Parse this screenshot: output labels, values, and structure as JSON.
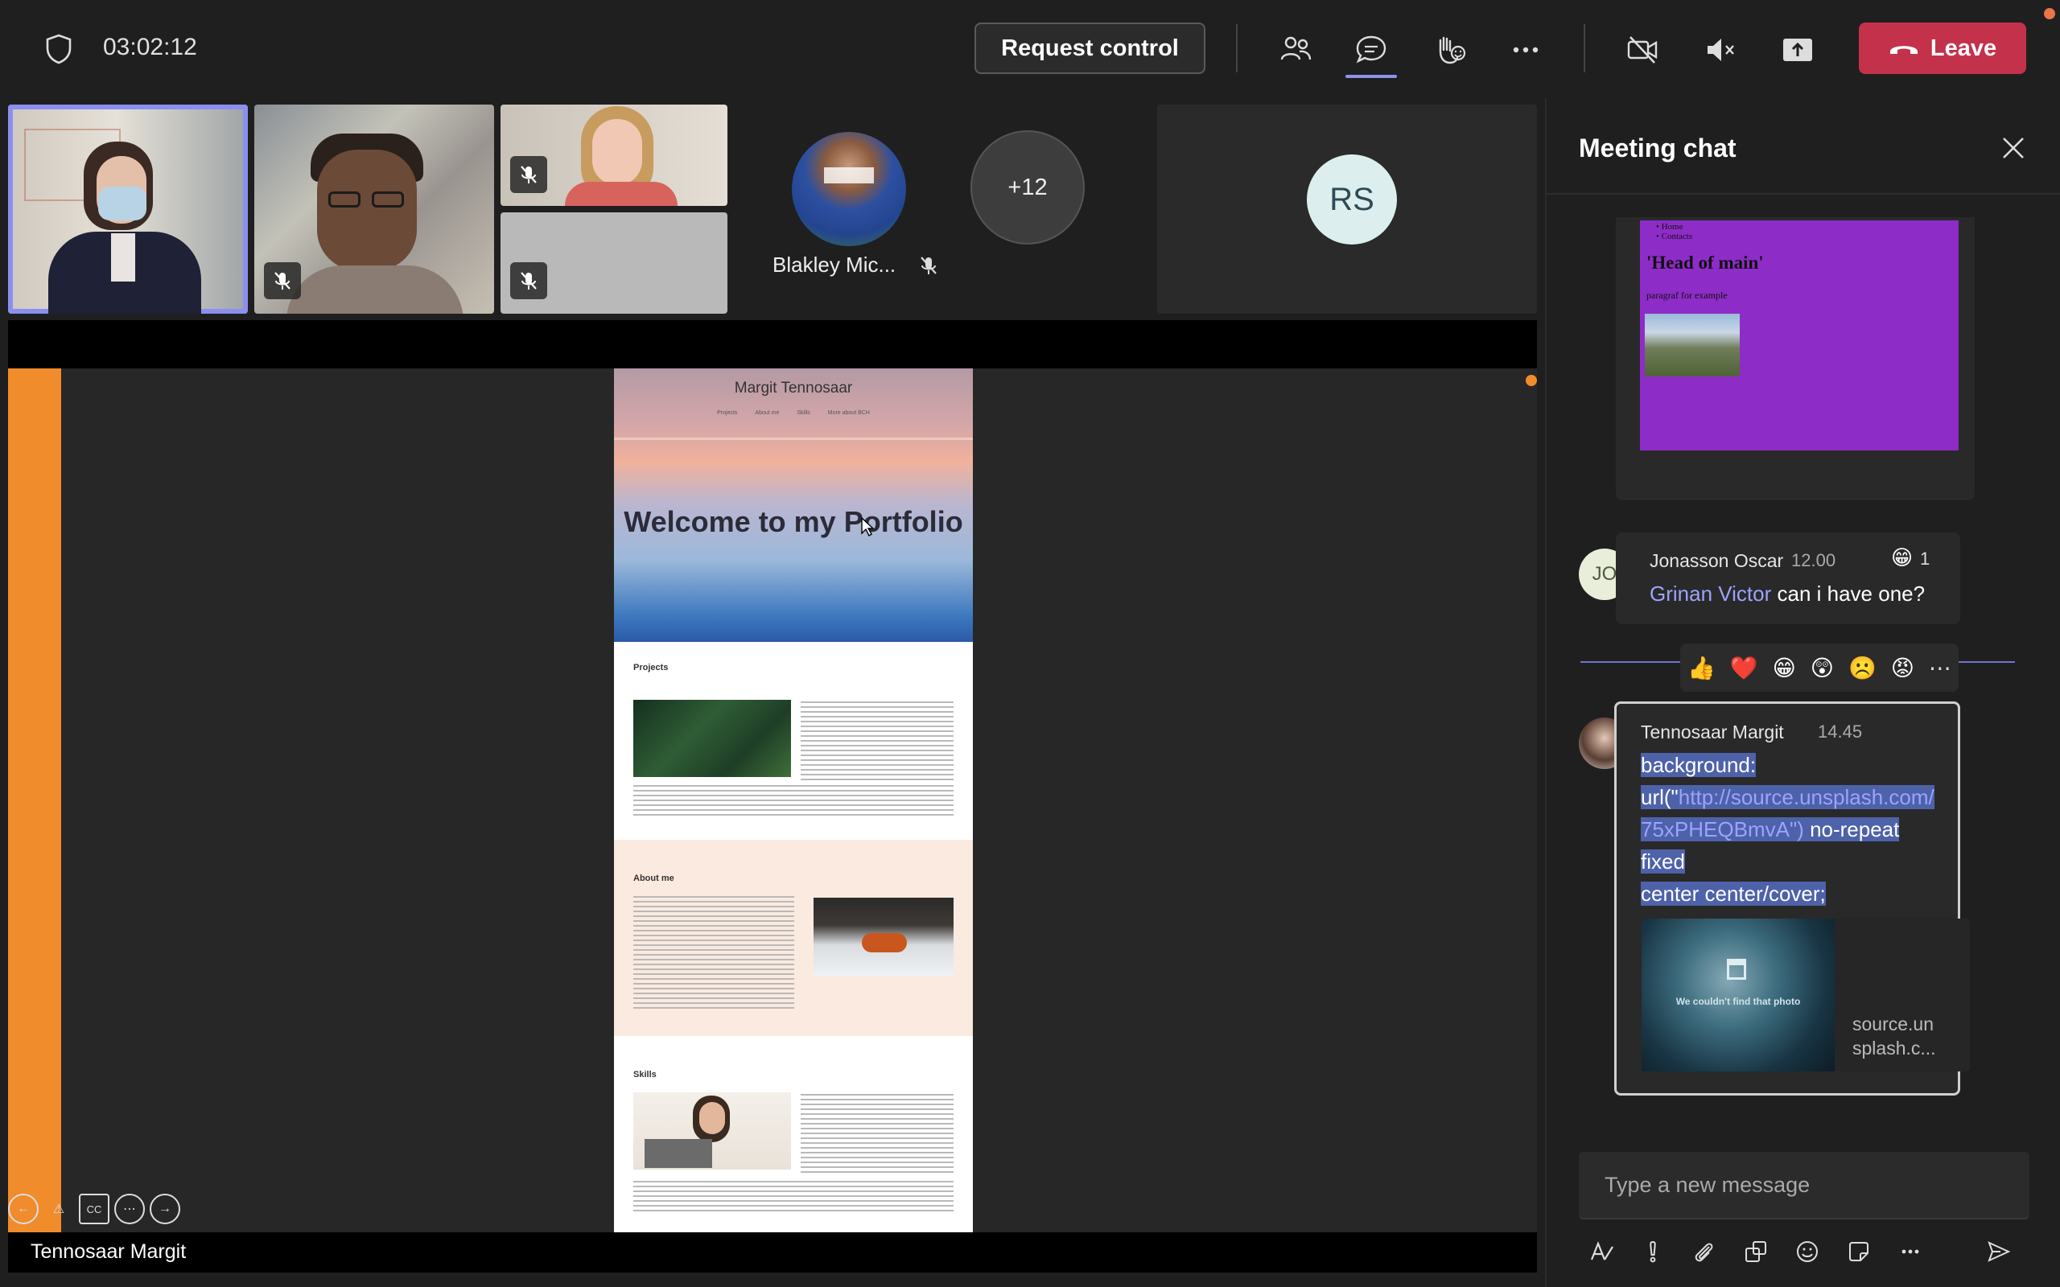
{
  "topbar": {
    "timer": "03:02:12",
    "request_control_label": "Request control",
    "leave_label": "Leave"
  },
  "participants": {
    "overflow_count": "+12",
    "named_avatar_name": "Blakley Mic...",
    "rs_initials": "RS"
  },
  "share": {
    "presenter_name": "Tennosaar Margit",
    "doc": {
      "site_name": "Margit Tennosaar",
      "nav": [
        "Projects",
        "About me",
        "Skills",
        "More about BCH"
      ],
      "hero_heading": "Welcome to my Portfolio",
      "sections": [
        "Projects",
        "About me",
        "Skills"
      ]
    },
    "controls": [
      "←",
      "⚠",
      "CC",
      "⋯",
      "→"
    ]
  },
  "chat": {
    "title": "Meeting chat",
    "shared_image": {
      "list_items": [
        "Home",
        "Contacts"
      ],
      "heading": "'Head of main'",
      "paragraph": "paragraf for example"
    },
    "messages": [
      {
        "initials": "JO",
        "sender": "Jonasson Oscar",
        "time": "12.00",
        "reaction": "😁",
        "reaction_count": "1",
        "mention": "Grinan Victor",
        "text": " can i have one?"
      },
      {
        "sender": "Tennosaar Margit",
        "time": "14.45",
        "lines": [
          "background:",
          "url(\"",
          "http://source.unsplash.com/",
          "75xPHEQBmvA\")",
          " no-repeat",
          "fixed",
          "center center/cover;"
        ],
        "preview_text": "We couldn't find that photo",
        "preview_host_1": "source.un",
        "preview_host_2": "splash.c..."
      }
    ],
    "reactions": [
      "👍",
      "❤️",
      "😁",
      "😲",
      "☹️",
      "😡",
      "⋯"
    ],
    "compose_placeholder": "Type a new message"
  },
  "colors": {
    "accent": "#8b8ff0",
    "leave": "#c4314b",
    "presenter_bar": "#f08c2c",
    "mention": "#9ea2ff",
    "selection": "#4d62a9"
  }
}
